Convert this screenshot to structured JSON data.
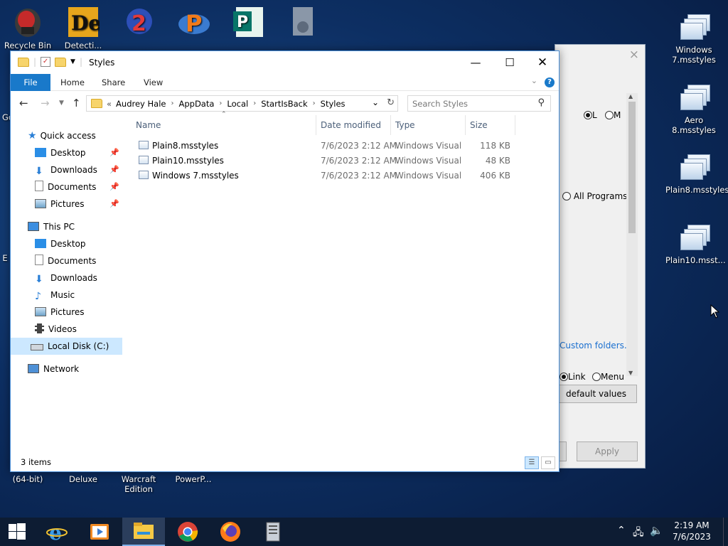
{
  "desktop": {
    "left_icons": [
      {
        "label": "Recycle Bin",
        "name": "recycle-bin"
      },
      {
        "label": "Detecti...",
        "name": "detective"
      },
      {
        "label": "",
        "name": "app-2"
      },
      {
        "label": "",
        "name": "app-p"
      },
      {
        "label": "",
        "name": "app-publisher"
      },
      {
        "label": "",
        "name": "app-gear"
      }
    ],
    "right_icons": [
      {
        "label": "Windows 7.msstyles"
      },
      {
        "label": "Aero 8.msstyles"
      },
      {
        "label": "Plain8.msstyles"
      },
      {
        "label": "Plain10.msst..."
      }
    ],
    "bottom_labels": [
      "(64-bit)",
      "Deluxe",
      "Warcraft Edition",
      "PowerP..."
    ],
    "partial_labels": [
      "Go",
      "E"
    ]
  },
  "bg_window": {
    "close": "×",
    "radio1": "L",
    "radio2": "M",
    "all_programs": "All Programs",
    "custom_folders": "Custom folders...",
    "link": "Link",
    "menu": "Menu",
    "default_values": "default values",
    "apply": "Apply"
  },
  "explorer": {
    "title": "Styles",
    "ribbon": {
      "file": "File",
      "home": "Home",
      "share": "Share",
      "view": "View",
      "help": "?"
    },
    "address": {
      "prefix": "«",
      "crumbs": [
        "Audrey Hale",
        "AppData",
        "Local",
        "StartIsBack",
        "Styles"
      ]
    },
    "search_placeholder": "Search Styles",
    "nav": {
      "quick_access": "Quick access",
      "qa_items": [
        "Desktop",
        "Downloads",
        "Documents",
        "Pictures"
      ],
      "this_pc": "This PC",
      "pc_items": [
        "Desktop",
        "Documents",
        "Downloads",
        "Music",
        "Pictures",
        "Videos",
        "Local Disk (C:)"
      ],
      "network": "Network"
    },
    "columns": {
      "name": "Name",
      "date": "Date modified",
      "type": "Type",
      "size": "Size"
    },
    "files": [
      {
        "name": "Plain8.msstyles",
        "date": "7/6/2023 2:12 AM",
        "type": "Windows Visual ...",
        "size": "118 KB"
      },
      {
        "name": "Plain10.msstyles",
        "date": "7/6/2023 2:12 AM",
        "type": "Windows Visual ...",
        "size": "48 KB"
      },
      {
        "name": "Windows 7.msstyles",
        "date": "7/6/2023 2:12 AM",
        "type": "Windows Visual ...",
        "size": "406 KB"
      }
    ],
    "status": "3 items"
  },
  "taskbar": {
    "time": "2:19 AM",
    "date": "7/6/2023"
  }
}
